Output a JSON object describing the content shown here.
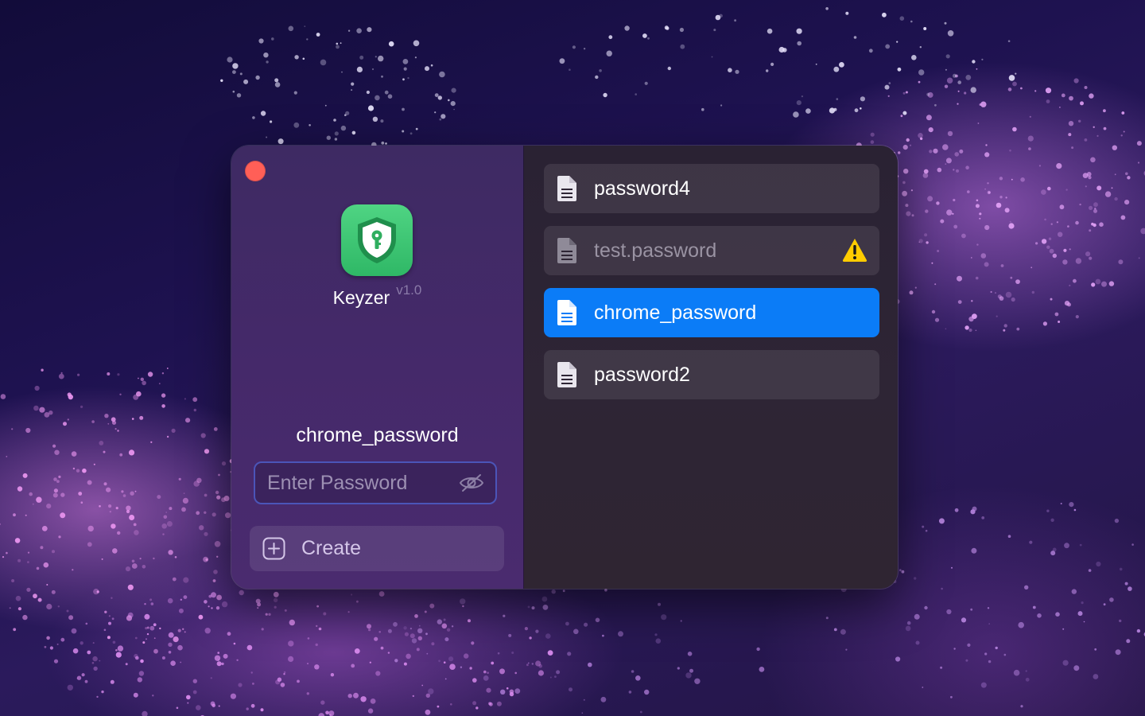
{
  "app": {
    "name": "Keyzer",
    "version": "v1.0",
    "icon": "shield-keyhole-icon"
  },
  "window": {
    "close_icon": "close-window-icon"
  },
  "left_pane": {
    "selected_file": "chrome_password",
    "password_field": {
      "placeholder": "Enter Password",
      "value": "",
      "toggle_icon": "eye-slash-icon"
    },
    "create_button": {
      "label": "Create",
      "icon": "plus-square-icon"
    }
  },
  "file_list": {
    "items": [
      {
        "name": "password4",
        "icon": "document-icon",
        "state": "normal",
        "warning": false
      },
      {
        "name": "test.password",
        "icon": "document-icon",
        "state": "dimmed",
        "warning": true
      },
      {
        "name": "chrome_password",
        "icon": "document-icon",
        "state": "selected",
        "warning": false
      },
      {
        "name": "password2",
        "icon": "document-icon",
        "state": "normal",
        "warning": false
      }
    ]
  },
  "colors": {
    "accent_selected": "#0b7cf7",
    "close_button": "#ff5f57",
    "app_icon_green": "#3cc472",
    "warning_yellow": "#ffcc00",
    "field_border": "#4b55b8"
  }
}
